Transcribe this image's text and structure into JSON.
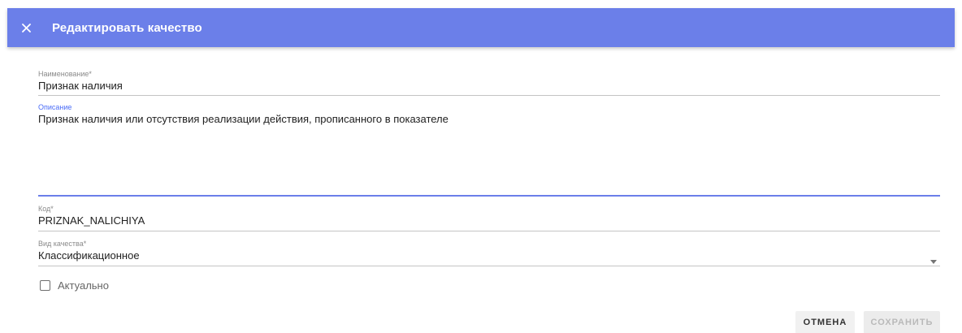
{
  "dialog": {
    "title": "Редактировать качество",
    "accent_color": "#6b7fe9",
    "close_icon": "close-icon"
  },
  "form": {
    "name": {
      "label": "Наименование*",
      "value": "Признак наличия"
    },
    "description": {
      "label": "Описание",
      "value": "Признак наличия или отсутствия реализации действия, прописанного в показателе"
    },
    "code": {
      "label": "Код*",
      "value": "PRIZNAK_NALICHIYA"
    },
    "quality_type": {
      "label": "Вид качества*",
      "value": "Классификационное",
      "icon": "chevron-down-icon"
    },
    "actual": {
      "label": "Актуально",
      "checked": false
    }
  },
  "actions": {
    "cancel_label": "ОТМЕНА",
    "save_label": "СОХРАНИТЬ"
  }
}
